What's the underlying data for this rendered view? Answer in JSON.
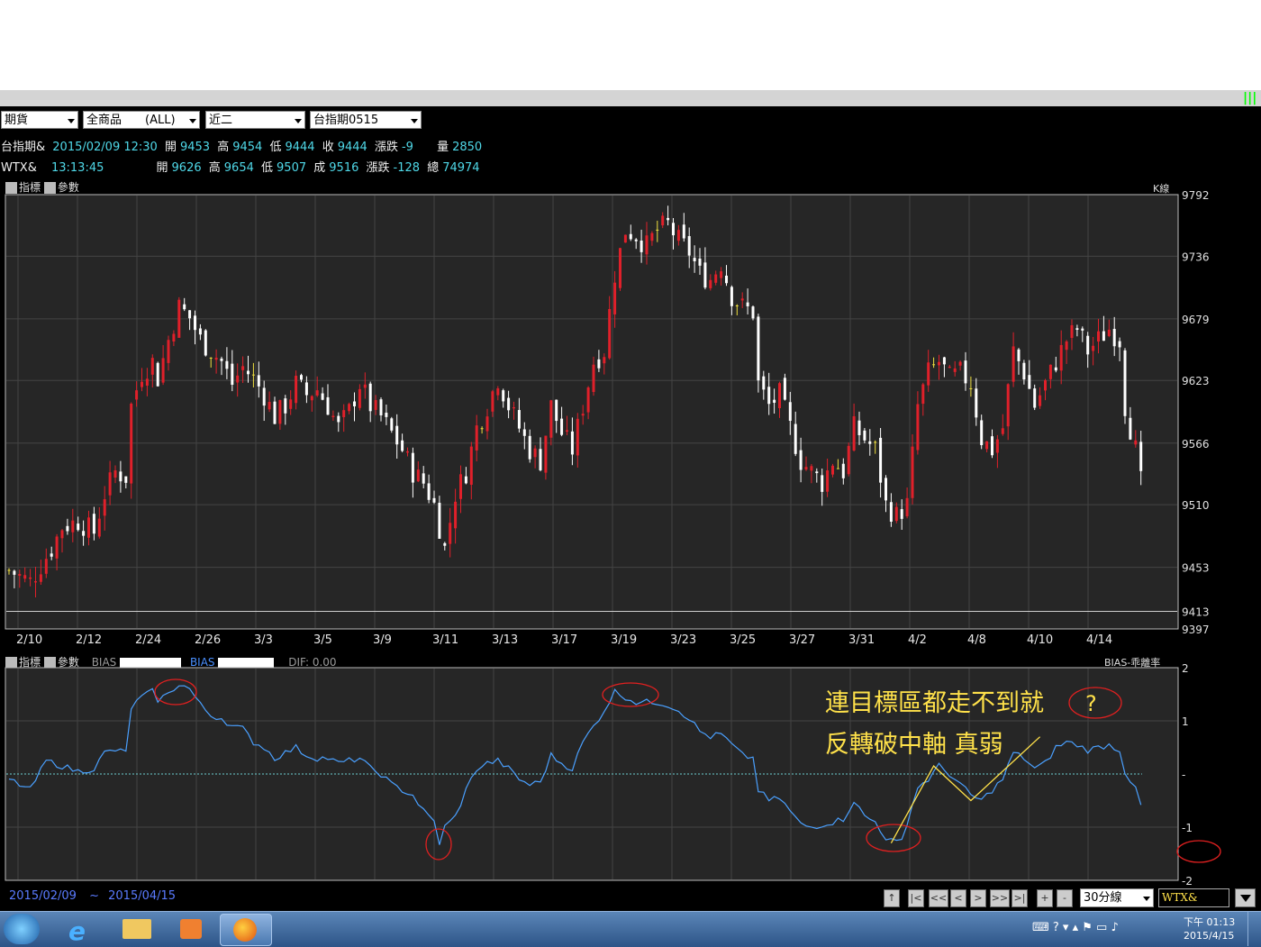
{
  "toolbar": {
    "market": "期貨",
    "product": "全商品　　(ALL)",
    "period": "近二",
    "contract": "台指期0515"
  },
  "quote1": {
    "name": "台指期&",
    "datetime": "2015/02/09 12:30",
    "open_label": "開",
    "open": "9453",
    "high_label": "高",
    "high": "9454",
    "low_label": "低",
    "low": "9444",
    "close_label": "收",
    "close": "9444",
    "chg_label": "漲跌",
    "chg": "-9",
    "vol_label": "量",
    "vol": "2850"
  },
  "quote2": {
    "name": "WTX&",
    "time": "13:13:45",
    "open_label": "開",
    "open": "9626",
    "high_label": "高",
    "high": "9654",
    "low_label": "低",
    "low": "9507",
    "close_label": "成",
    "close": "9516",
    "chg_label": "漲跌",
    "chg": "-128",
    "vol_label": "總",
    "vol": "74974"
  },
  "panel_tabs": {
    "indicator": "指標",
    "params": "參數",
    "kline_label": "K線",
    "bias_a": "BIAS",
    "bias_b": "BIAS",
    "dif_label": "DIF:",
    "dif_value": "0.00",
    "bias_name": "BIAS-乖離率"
  },
  "annotation": {
    "line1": "連目標區都走不到就",
    "line2": "反轉破中軸 真弱",
    "question": "?"
  },
  "bottom": {
    "date_from": "2015/02/09",
    "tilde": "~",
    "date_to": "2015/04/15",
    "interval": "30分線",
    "symbol": "WTX&",
    "btn_up": "↑",
    "btn_first": "|<",
    "btn_fastback": "<<",
    "btn_back": "<",
    "btn_fwd": ">",
    "btn_fastfwd": ">>",
    "btn_last": ">|",
    "btn_plus": "+",
    "btn_minus": "-"
  },
  "taskbar": {
    "clock_time": "下午 01:13",
    "clock_date": "2015/4/15"
  },
  "colors": {
    "up": "#e0202a",
    "down": "#ffffff",
    "flat": "#f0e040",
    "bias_line": "#4aa0ff",
    "grid": "#444444",
    "annot": "#ffe14a",
    "circle": "#e02020"
  },
  "chart_data": [
    {
      "type": "candlestick",
      "ylabel": "",
      "ylim": [
        9397,
        9792
      ],
      "yticks": [
        9792,
        9736,
        9679,
        9623,
        9566,
        9510,
        9453,
        9413,
        9397
      ],
      "xtick_labels": [
        "2/10",
        "2/12",
        "2/24",
        "2/26",
        "3/3",
        "3/5",
        "3/9",
        "3/11",
        "3/13",
        "3/17",
        "3/19",
        "3/23",
        "3/25",
        "3/27",
        "3/31",
        "4/2",
        "4/8",
        "4/10",
        "4/14"
      ],
      "close_path": [
        [
          0,
          9450
        ],
        [
          4,
          9440
        ],
        [
          8,
          9470
        ],
        [
          10,
          9490
        ],
        [
          13,
          9495
        ],
        [
          16,
          9485
        ],
        [
          18,
          9520
        ],
        [
          20,
          9540
        ],
        [
          22,
          9535
        ],
        [
          23,
          9600
        ],
        [
          25,
          9630
        ],
        [
          27,
          9640
        ],
        [
          28,
          9625
        ],
        [
          30,
          9660
        ],
        [
          32,
          9690
        ],
        [
          34,
          9680
        ],
        [
          36,
          9660
        ],
        [
          38,
          9650
        ],
        [
          40,
          9640
        ],
        [
          42,
          9620
        ],
        [
          44,
          9635
        ],
        [
          46,
          9625
        ],
        [
          48,
          9610
        ],
        [
          50,
          9590
        ],
        [
          52,
          9600
        ],
        [
          54,
          9620
        ],
        [
          56,
          9610
        ],
        [
          58,
          9615
        ],
        [
          60,
          9600
        ],
        [
          62,
          9580
        ],
        [
          64,
          9595
        ],
        [
          66,
          9620
        ],
        [
          68,
          9600
        ],
        [
          70,
          9590
        ],
        [
          72,
          9575
        ],
        [
          74,
          9560
        ],
        [
          76,
          9540
        ],
        [
          78,
          9530
        ],
        [
          80,
          9510
        ],
        [
          82,
          9470
        ],
        [
          84,
          9520
        ],
        [
          86,
          9540
        ],
        [
          88,
          9580
        ],
        [
          90,
          9600
        ],
        [
          92,
          9625
        ],
        [
          94,
          9600
        ],
        [
          96,
          9580
        ],
        [
          98,
          9560
        ],
        [
          100,
          9550
        ],
        [
          102,
          9600
        ],
        [
          104,
          9575
        ],
        [
          106,
          9560
        ],
        [
          108,
          9600
        ],
        [
          110,
          9640
        ],
        [
          112,
          9650
        ],
        [
          114,
          9720
        ],
        [
          116,
          9760
        ],
        [
          118,
          9755
        ],
        [
          120,
          9745
        ],
        [
          122,
          9760
        ],
        [
          124,
          9765
        ],
        [
          126,
          9750
        ],
        [
          128,
          9740
        ],
        [
          130,
          9720
        ],
        [
          132,
          9715
        ],
        [
          134,
          9730
        ],
        [
          136,
          9700
        ],
        [
          138,
          9690
        ],
        [
          140,
          9685
        ],
        [
          141,
          9620
        ],
        [
          143,
          9600
        ],
        [
          145,
          9610
        ],
        [
          147,
          9580
        ],
        [
          149,
          9550
        ],
        [
          151,
          9540
        ],
        [
          153,
          9530
        ],
        [
          155,
          9550
        ],
        [
          157,
          9540
        ],
        [
          159,
          9580
        ],
        [
          161,
          9570
        ],
        [
          163,
          9560
        ],
        [
          165,
          9510
        ],
        [
          167,
          9500
        ],
        [
          169,
          9510
        ],
        [
          171,
          9600
        ],
        [
          173,
          9630
        ],
        [
          175,
          9640
        ],
        [
          177,
          9625
        ],
        [
          179,
          9630
        ],
        [
          181,
          9620
        ],
        [
          183,
          9570
        ],
        [
          185,
          9560
        ],
        [
          187,
          9580
        ],
        [
          189,
          9650
        ],
        [
          191,
          9630
        ],
        [
          193,
          9600
        ],
        [
          195,
          9620
        ],
        [
          197,
          9640
        ],
        [
          199,
          9660
        ],
        [
          201,
          9670
        ],
        [
          203,
          9650
        ],
        [
          205,
          9660
        ],
        [
          207,
          9670
        ],
        [
          209,
          9660
        ],
        [
          210,
          9600
        ],
        [
          212,
          9560
        ],
        [
          213,
          9530
        ]
      ]
    },
    {
      "type": "line",
      "series": [
        {
          "name": "BIAS",
          "color": "#4aa0ff"
        }
      ],
      "ylim": [
        -2,
        2
      ],
      "yticks": [
        2,
        1,
        0,
        -1,
        -2
      ],
      "ytick_labels": [
        "2",
        "1",
        "-",
        "-1",
        "-2"
      ],
      "values_path": [
        [
          0,
          -0.1
        ],
        [
          4,
          -0.3
        ],
        [
          7,
          0.25
        ],
        [
          10,
          0.15
        ],
        [
          13,
          0.05
        ],
        [
          16,
          0.1
        ],
        [
          18,
          0.4
        ],
        [
          20,
          0.45
        ],
        [
          22,
          0.4
        ],
        [
          23,
          1.25
        ],
        [
          25,
          1.45
        ],
        [
          27,
          1.55
        ],
        [
          28,
          1.4
        ],
        [
          30,
          1.5
        ],
        [
          32,
          1.7
        ],
        [
          34,
          1.6
        ],
        [
          36,
          1.3
        ],
        [
          38,
          1.1
        ],
        [
          40,
          1.05
        ],
        [
          42,
          0.9
        ],
        [
          44,
          0.85
        ],
        [
          46,
          0.6
        ],
        [
          48,
          0.5
        ],
        [
          50,
          0.3
        ],
        [
          52,
          0.4
        ],
        [
          54,
          0.5
        ],
        [
          56,
          0.35
        ],
        [
          58,
          0.3
        ],
        [
          60,
          0.3
        ],
        [
          62,
          0.2
        ],
        [
          64,
          0.25
        ],
        [
          66,
          0.3
        ],
        [
          68,
          0.1
        ],
        [
          70,
          0.0
        ],
        [
          72,
          -0.2
        ],
        [
          74,
          -0.3
        ],
        [
          76,
          -0.4
        ],
        [
          78,
          -0.7
        ],
        [
          80,
          -0.9
        ],
        [
          81,
          -1.3
        ],
        [
          82,
          -1.0
        ],
        [
          84,
          -0.8
        ],
        [
          86,
          -0.3
        ],
        [
          88,
          0.1
        ],
        [
          90,
          0.2
        ],
        [
          92,
          0.25
        ],
        [
          94,
          0.1
        ],
        [
          96,
          -0.1
        ],
        [
          98,
          -0.2
        ],
        [
          100,
          -0.15
        ],
        [
          102,
          0.35
        ],
        [
          104,
          0.2
        ],
        [
          106,
          0.1
        ],
        [
          108,
          0.6
        ],
        [
          110,
          0.9
        ],
        [
          112,
          1.2
        ],
        [
          114,
          1.55
        ],
        [
          116,
          1.45
        ],
        [
          118,
          1.35
        ],
        [
          120,
          1.35
        ],
        [
          122,
          1.35
        ],
        [
          124,
          1.3
        ],
        [
          126,
          1.2
        ],
        [
          128,
          1.05
        ],
        [
          130,
          0.8
        ],
        [
          132,
          0.7
        ],
        [
          134,
          0.75
        ],
        [
          136,
          0.55
        ],
        [
          138,
          0.35
        ],
        [
          140,
          0.3
        ],
        [
          141,
          -0.3
        ],
        [
          143,
          -0.5
        ],
        [
          145,
          -0.45
        ],
        [
          147,
          -0.7
        ],
        [
          149,
          -0.95
        ],
        [
          151,
          -1.0
        ],
        [
          153,
          -0.95
        ],
        [
          155,
          -0.9
        ],
        [
          157,
          -0.85
        ],
        [
          159,
          -0.5
        ],
        [
          161,
          -0.8
        ],
        [
          163,
          -0.9
        ],
        [
          165,
          -1.2
        ],
        [
          167,
          -1.3
        ],
        [
          168,
          -1.25
        ],
        [
          169,
          -0.9
        ],
        [
          171,
          -0.25
        ],
        [
          173,
          -0.1
        ],
        [
          175,
          0.15
        ],
        [
          177,
          0.0
        ],
        [
          179,
          -0.2
        ],
        [
          181,
          -0.4
        ],
        [
          183,
          -0.5
        ],
        [
          185,
          -0.3
        ],
        [
          187,
          -0.1
        ],
        [
          189,
          0.4
        ],
        [
          191,
          0.3
        ],
        [
          193,
          0.1
        ],
        [
          195,
          0.2
        ],
        [
          197,
          0.5
        ],
        [
          199,
          0.6
        ],
        [
          201,
          0.55
        ],
        [
          203,
          0.45
        ],
        [
          205,
          0.5
        ],
        [
          207,
          0.55
        ],
        [
          209,
          0.45
        ],
        [
          210,
          0.05
        ],
        [
          212,
          -0.3
        ],
        [
          213,
          -0.6
        ]
      ],
      "annotation_overlay_path": [
        [
          166,
          -1.3
        ],
        [
          174,
          0.15
        ],
        [
          181,
          -0.5
        ],
        [
          194,
          0.7
        ]
      ]
    }
  ]
}
